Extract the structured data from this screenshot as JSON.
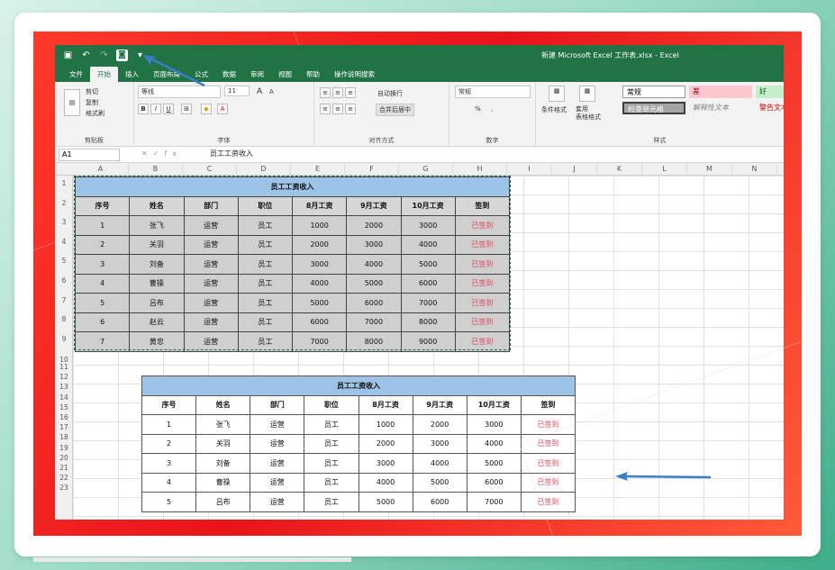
{
  "window": {
    "title": "新建 Microsoft Excel 工作表.xlsx - Excel"
  },
  "qat": {
    "icons": [
      "save-icon",
      "undo-icon",
      "redo-icon",
      "camera-icon",
      "customize-icon"
    ]
  },
  "tabs": [
    "文件",
    "开始",
    "插入",
    "页面布局",
    "公式",
    "数据",
    "审阅",
    "视图",
    "帮助",
    "操作说明搜索"
  ],
  "active_tab": "开始",
  "ribbon": {
    "clipboard": {
      "cut": "剪切",
      "copy": "复制",
      "painter": "格式刷",
      "label": "剪贴板"
    },
    "font": {
      "name": "等线",
      "size": "11",
      "label": "字体",
      "bold": "B",
      "italic": "I",
      "underline": "U",
      "grow": "A",
      "shrink": "A"
    },
    "alignment": {
      "wrap": "自动换行",
      "merge": "合并后居中",
      "label": "对齐方式"
    },
    "number": {
      "format": "常规",
      "percent": "%",
      "comma": ",",
      "label": "数字"
    },
    "styles": {
      "conditional": "条件格式",
      "table": "套用\n表格格式",
      "normal": "常规",
      "bad": "差",
      "good": "好",
      "check": "检查单元格",
      "explanatory": "解释性文本",
      "warning": "警告文本",
      "label": "样式"
    }
  },
  "formula_bar": {
    "name_box": "A1",
    "fx": "fx",
    "value": "员工工资收入"
  },
  "columns": [
    "A",
    "B",
    "C",
    "D",
    "E",
    "F",
    "G",
    "H",
    "I",
    "J",
    "K",
    "L",
    "M",
    "N"
  ],
  "rows": [
    "1",
    "2",
    "3",
    "4",
    "5",
    "6",
    "7",
    "8",
    "9",
    "10",
    "11",
    "12",
    "13",
    "14",
    "15",
    "16",
    "17",
    "18",
    "19",
    "20",
    "21",
    "22",
    "23"
  ],
  "table1": {
    "title": "员工工资收入",
    "headers": [
      "序号",
      "姓名",
      "部门",
      "职位",
      "8月工资",
      "9月工资",
      "10月工资",
      "签到"
    ],
    "rows": [
      [
        "1",
        "张飞",
        "运营",
        "员工",
        "1000",
        "2000",
        "3000",
        "已签到"
      ],
      [
        "2",
        "关羽",
        "运营",
        "员工",
        "2000",
        "3000",
        "4000",
        "已签到"
      ],
      [
        "3",
        "刘备",
        "运营",
        "员工",
        "3000",
        "4000",
        "5000",
        "已签到"
      ],
      [
        "4",
        "曹操",
        "运营",
        "员工",
        "4000",
        "5000",
        "6000",
        "已签到"
      ],
      [
        "5",
        "吕布",
        "运营",
        "员工",
        "5000",
        "6000",
        "7000",
        "已签到"
      ],
      [
        "6",
        "赵云",
        "运营",
        "员工",
        "6000",
        "7000",
        "8000",
        "已签到"
      ],
      [
        "7",
        "黄忠",
        "运营",
        "员工",
        "7000",
        "8000",
        "9000",
        "已签到"
      ]
    ]
  },
  "table2": {
    "title": "员工工资收入",
    "headers": [
      "序号",
      "姓名",
      "部门",
      "职位",
      "8月工资",
      "9月工资",
      "10月工资",
      "签到"
    ],
    "rows": [
      [
        "1",
        "张飞",
        "运营",
        "员工",
        "1000",
        "2000",
        "3000",
        "已签到"
      ],
      [
        "2",
        "关羽",
        "运营",
        "员工",
        "2000",
        "3000",
        "4000",
        "已签到"
      ],
      [
        "3",
        "刘备",
        "运营",
        "员工",
        "3000",
        "4000",
        "5000",
        "已签到"
      ],
      [
        "4",
        "曹操",
        "运营",
        "员工",
        "4000",
        "5000",
        "6000",
        "已签到"
      ],
      [
        "5",
        "吕布",
        "运营",
        "员工",
        "5000",
        "6000",
        "7000",
        "已签到"
      ]
    ]
  },
  "colors": {
    "excel_green": "#217346",
    "title_fill": "#9dc3e6",
    "signed_text": "#e0435a",
    "arrow": "#3a7fc4"
  }
}
